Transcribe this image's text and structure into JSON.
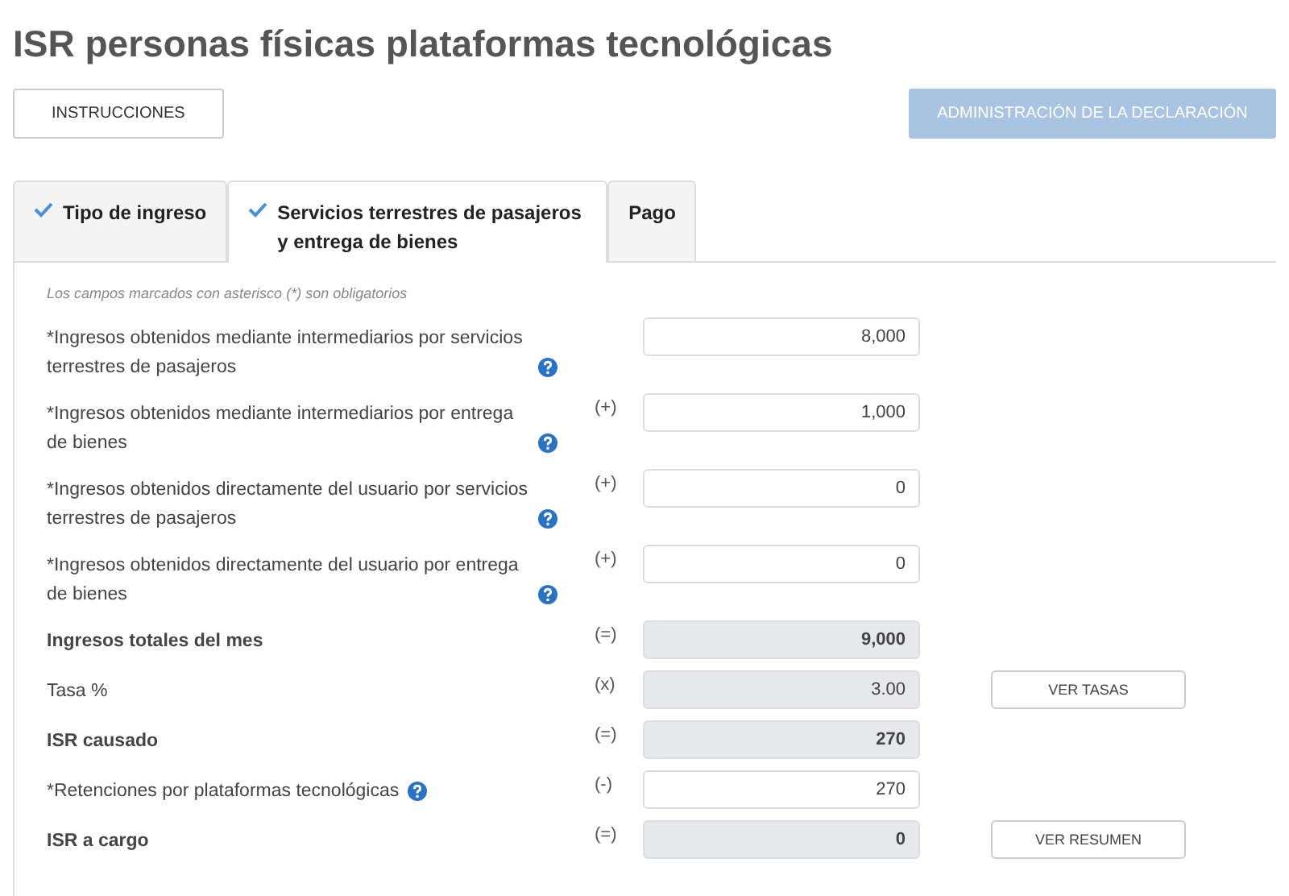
{
  "title": "ISR personas físicas plataformas tecnológicas",
  "header_buttons": [
    {
      "label": "INSTRUCCIONES",
      "disabled": false
    },
    {
      "label": "ADMINISTRACIÓN DE LA DECLARACIÓN",
      "disabled": true
    }
  ],
  "tabs": [
    {
      "label": "Tipo de ingreso",
      "checked": true,
      "selected": false
    },
    {
      "label": "Servicios terrestres de pasajeros y entrega de bienes",
      "checked": true,
      "selected": true
    },
    {
      "label": "Pago",
      "checked": false,
      "selected": false
    }
  ],
  "note": "Los campos marcados con asterisco (*) son obligatorios",
  "rows": [
    {
      "label": "*Ingresos obtenidos mediante intermediarios por servicios terrestres de pasajeros",
      "help": true,
      "bold": false,
      "kind": "input",
      "value": "8,000"
    },
    {
      "label": "*Ingresos obtenidos mediante intermediarios por entrega de bienes",
      "help": true,
      "bold": false,
      "operator": "(+)",
      "kind": "input",
      "value": "1,000"
    },
    {
      "label": "*Ingresos obtenidos directamente del usuario por servicios terrestres de pasajeros",
      "help": true,
      "bold": false,
      "operator": "(+)",
      "kind": "input",
      "value": "0"
    },
    {
      "label": "*Ingresos obtenidos directamente del usuario por entrega de bienes",
      "help": true,
      "bold": false,
      "operator": "(+)",
      "kind": "input",
      "value": "0"
    },
    {
      "label": "Ingresos totales del mes",
      "help": false,
      "bold": true,
      "operator": "(=)",
      "kind": "readonly",
      "value": "9,000"
    },
    {
      "label": "Tasa %",
      "help": false,
      "bold": false,
      "operator": "(x)",
      "kind": "readonly",
      "value": "3.00",
      "button": "VER TASAS"
    },
    {
      "label": "ISR causado",
      "help": false,
      "bold": true,
      "operator": "(=)",
      "kind": "readonly",
      "value": "270"
    },
    {
      "label": "*Retenciones por plataformas tecnológicas",
      "help": true,
      "bold": false,
      "operator": "(-)",
      "kind": "input",
      "value": "270"
    },
    {
      "label": "ISR a cargo",
      "help": false,
      "bold": true,
      "operator": "(=)",
      "kind": "readonly",
      "value": "0",
      "button": "VER RESUMEN"
    }
  ]
}
